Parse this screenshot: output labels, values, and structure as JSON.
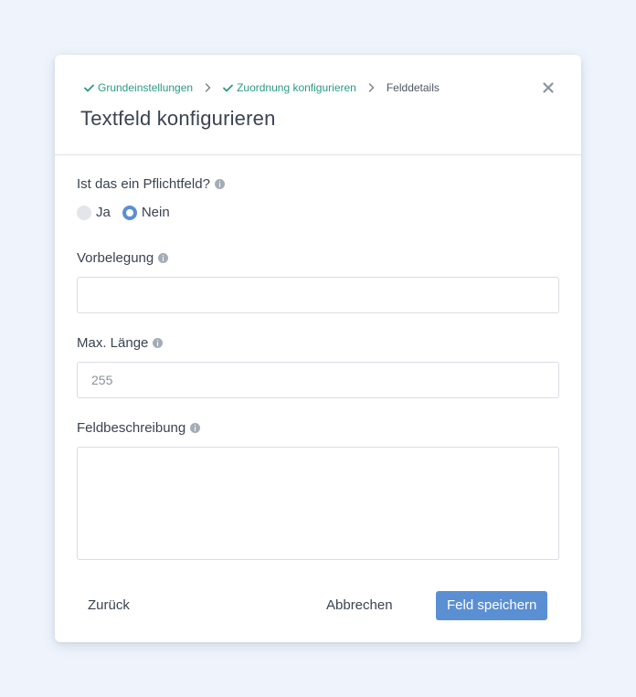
{
  "breadcrumb": {
    "step1": "Grundeinstellungen",
    "step2": "Zuordnung konfigurieren",
    "step3": "Felddetails"
  },
  "dialog": {
    "title": "Textfeld konfigurieren"
  },
  "required": {
    "label": "Ist das ein Pflichtfeld?",
    "options": [
      "Ja",
      "Nein"
    ],
    "selected": "Nein"
  },
  "default_value": {
    "label": "Vorbelegung",
    "value": ""
  },
  "max_length": {
    "label": "Max. Länge",
    "placeholder": "255",
    "value": ""
  },
  "description": {
    "label": "Feldbeschreibung",
    "value": ""
  },
  "footer": {
    "back": "Zurück",
    "cancel": "Abbrechen",
    "save": "Feld speichern"
  },
  "colors": {
    "accent": "#5b8fd4",
    "done_step": "#2a9a83",
    "background": "#eff4fc"
  }
}
